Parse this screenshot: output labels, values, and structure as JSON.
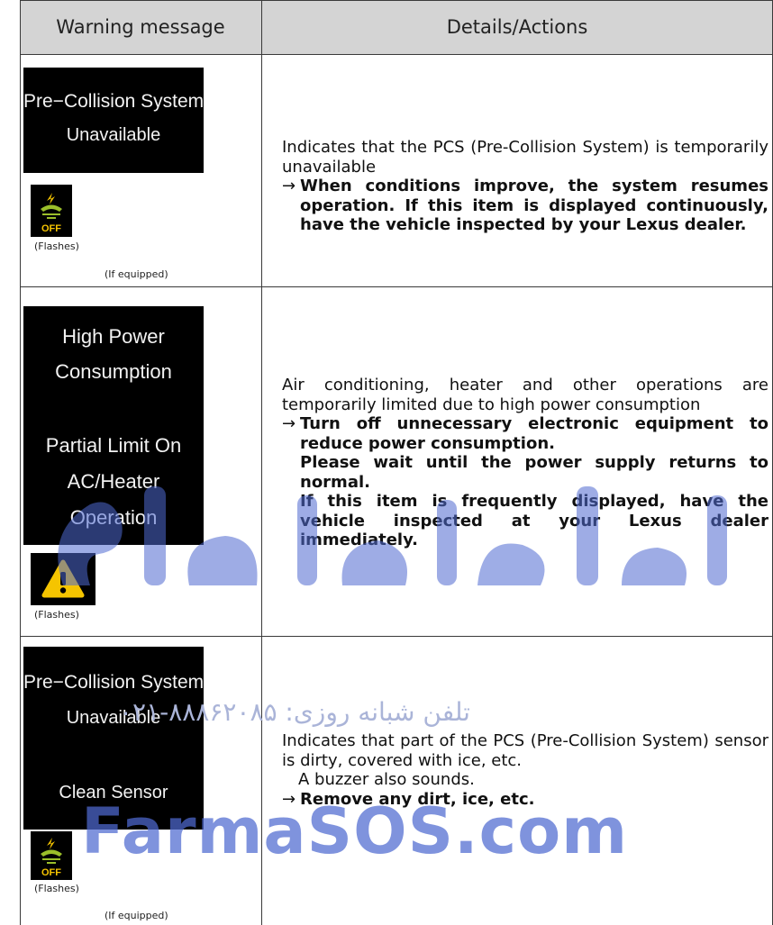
{
  "table": {
    "headers": [
      "Warning message",
      "Details/Actions"
    ],
    "rows": [
      {
        "screen_lines": [
          "Pre−Collision System",
          "Unavailable"
        ],
        "lamp_icon": "pcs-off-icon",
        "lamp_label": "OFF",
        "flash_caption": "(Flashes)",
        "equip_caption": "(If equipped)",
        "description": "Indicates that the PCS (Pre-Collision System) is temporarily unavailable",
        "action": "When conditions improve, the system resumes operation. If this item is displayed continuously, have the vehicle inspected by your Lexus dealer."
      },
      {
        "screen_lines": [
          "High Power",
          "Consumption",
          "Partial Limit On",
          "AC/Heater",
          "Operation"
        ],
        "lamp_icon": "master-warning-icon",
        "flash_caption": "(Flashes)",
        "description": "Air conditioning, heater and other operations are temporarily limited due to high power consumption",
        "action": "Turn off unnecessary electronic equipment to reduce power consumption.",
        "action_extra": [
          "Please wait until the power supply returns to normal.",
          "If this item is frequently displayed, have the vehicle inspected at your Lexus dealer immediately."
        ]
      },
      {
        "screen_lines": [
          "Pre−Collision System",
          "Unavailable",
          "Clean Sensor"
        ],
        "lamp_icon": "pcs-off-icon",
        "lamp_label": "OFF",
        "flash_caption": "(Flashes)",
        "equip_caption": "(If equipped)",
        "description": "Indicates that part of the PCS (Pre-Collision System) sensor is dirty, covered with ice, etc.",
        "note": "A buzzer also sounds.",
        "action": "Remove any dirt, ice, etc."
      }
    ]
  },
  "symbols": {
    "arrow": "→"
  },
  "watermark": {
    "phone_text": "۰۲۱-۸۸۸۶۲۰۸۵ :تلفن شبانه روزی",
    "brand": "FarmaSOS.com",
    "persian_logo": "امدادخودرو فارا"
  },
  "colors": {
    "header_bg": "#d4d4d4",
    "warning_yellow": "#f5c400",
    "pcs_green": "#9bbf2a",
    "watermark_blue": "#4f6ad1"
  }
}
